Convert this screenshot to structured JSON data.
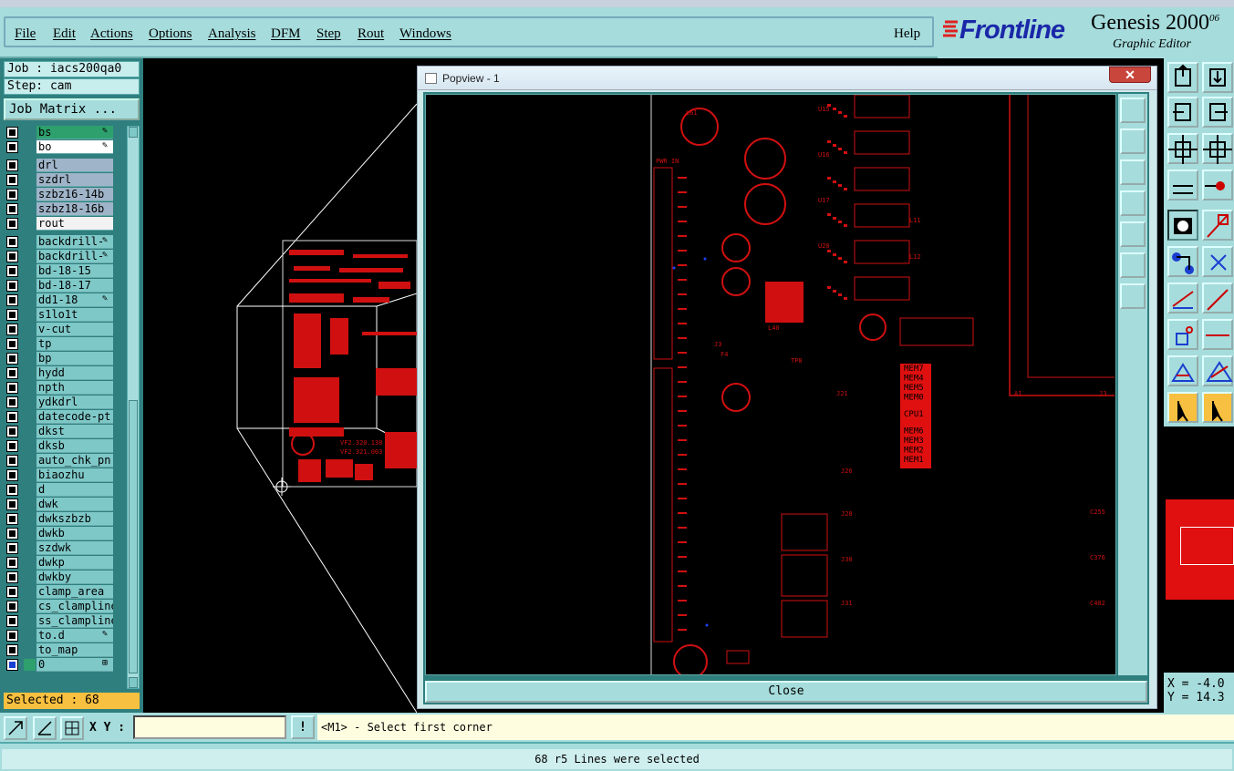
{
  "app": {
    "logo_text": "Frontline",
    "product": "Genesis 2000",
    "product_version_fragment": "06",
    "subtitle": "Graphic Editor"
  },
  "menu": [
    {
      "label": "File"
    },
    {
      "label": "Edit"
    },
    {
      "label": "Actions"
    },
    {
      "label": "Options"
    },
    {
      "label": "Analysis"
    },
    {
      "label": "DFM"
    },
    {
      "label": "Step"
    },
    {
      "label": "Rout"
    },
    {
      "label": "Windows"
    },
    {
      "label": "Help"
    }
  ],
  "left": {
    "job": "Job : iacs200qa0",
    "step": "Step: cam",
    "job_matrix": "Job Matrix ...",
    "selected": "Selected : 68"
  },
  "layers": [
    {
      "name": "bs",
      "cls": "sel",
      "flag": "✎"
    },
    {
      "name": "bo",
      "cls": "wsel",
      "flag": "✎"
    },
    {
      "name": "drl",
      "cls": "drill",
      "flag": ""
    },
    {
      "name": "szdrl",
      "cls": "drill",
      "flag": ""
    },
    {
      "name": "szbz16-14b",
      "cls": "drill",
      "flag": ""
    },
    {
      "name": "szbz18-16b",
      "cls": "drill",
      "flag": ""
    },
    {
      "name": "rout",
      "cls": "white",
      "flag": ""
    },
    {
      "name": "backdrill-",
      "cls": "board",
      "flag": "✎"
    },
    {
      "name": "backdrill-",
      "cls": "board",
      "flag": "✎"
    },
    {
      "name": "bd-18-15",
      "cls": "board",
      "flag": ""
    },
    {
      "name": "bd-18-17",
      "cls": "board",
      "flag": ""
    },
    {
      "name": "dd1-18",
      "cls": "board",
      "flag": "✎"
    },
    {
      "name": "s1lo1t",
      "cls": "board",
      "flag": ""
    },
    {
      "name": "v-cut",
      "cls": "board",
      "flag": ""
    },
    {
      "name": "tp",
      "cls": "board",
      "flag": ""
    },
    {
      "name": "bp",
      "cls": "board",
      "flag": ""
    },
    {
      "name": "hydd",
      "cls": "board",
      "flag": ""
    },
    {
      "name": "npth",
      "cls": "board",
      "flag": ""
    },
    {
      "name": "ydkdrl",
      "cls": "board",
      "flag": ""
    },
    {
      "name": "datecode-pt",
      "cls": "board",
      "flag": ""
    },
    {
      "name": "dkst",
      "cls": "board",
      "flag": ""
    },
    {
      "name": "dksb",
      "cls": "board",
      "flag": ""
    },
    {
      "name": "auto_chk_pn",
      "cls": "board",
      "flag": ""
    },
    {
      "name": "biaozhu",
      "cls": "board",
      "flag": ""
    },
    {
      "name": "d",
      "cls": "board",
      "flag": ""
    },
    {
      "name": "dwk",
      "cls": "board",
      "flag": ""
    },
    {
      "name": "dwkszbzb",
      "cls": "board",
      "flag": ""
    },
    {
      "name": "dwkb",
      "cls": "board",
      "flag": ""
    },
    {
      "name": "szdwk",
      "cls": "board",
      "flag": ""
    },
    {
      "name": "dwkp",
      "cls": "board",
      "flag": ""
    },
    {
      "name": "dwkby",
      "cls": "board",
      "flag": ""
    },
    {
      "name": "clamp_area",
      "cls": "board",
      "flag": ""
    },
    {
      "name": "cs_clampline",
      "cls": "board",
      "flag": ""
    },
    {
      "name": "ss_clampline",
      "cls": "board",
      "flag": ""
    },
    {
      "name": "to.d",
      "cls": "board",
      "flag": "✎"
    },
    {
      "name": "to_map",
      "cls": "board",
      "flag": ""
    },
    {
      "name": "0",
      "cls": "board",
      "flag": "⊞"
    }
  ],
  "popview": {
    "title": "Popview - 1",
    "close_x": "✕",
    "close_button": "Close",
    "board_labels": [
      "MEM7",
      "MEM4",
      "MEM5",
      "MEM0",
      "CPU1",
      "MEM6",
      "MEM3",
      "MEM2",
      "MEM1"
    ],
    "board_text": [
      "PWR IN",
      "L61",
      "U15",
      "U16",
      "U17",
      "U20",
      "L12",
      "L11",
      "J21",
      "J26",
      "J28",
      "J30",
      "J31",
      "L40",
      "TP8",
      "F4",
      "J3",
      "J3",
      "A1",
      "C255",
      "C376",
      "C402"
    ]
  },
  "coords": {
    "x": "X = -4.0",
    "y": "Y = 14.3"
  },
  "bottom": {
    "xy_label": "X Y :",
    "xy_value": "",
    "exclaim": "!",
    "prompt": "<M1> - Select first corner",
    "status": "68 r5 Lines were selected"
  },
  "colors": {
    "board": "#e01010",
    "panel": "#a6dcdc",
    "highlight": "#f8c040"
  }
}
